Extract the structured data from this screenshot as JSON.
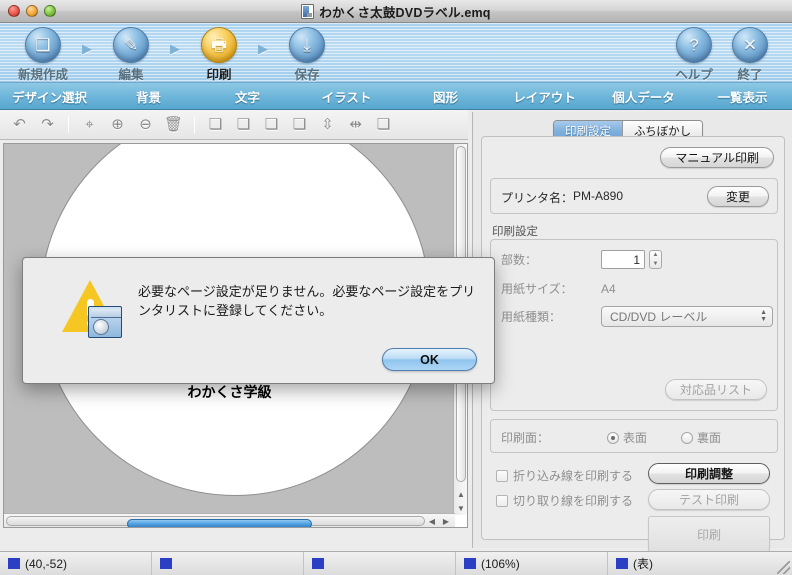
{
  "window": {
    "title": "わかくさ太鼓DVDラベル.emq",
    "doc_icon": "document-icon",
    "close_label": "",
    "minimize_label": "",
    "zoom_label": ""
  },
  "toolbar": {
    "steps": [
      {
        "label": "新規作成",
        "icon": "new-document-icon",
        "active": false
      },
      {
        "label": "編集",
        "icon": "edit-icon",
        "active": false
      },
      {
        "label": "印刷",
        "icon": "print-icon",
        "active": true
      },
      {
        "label": "保存",
        "icon": "save-icon",
        "active": false
      }
    ],
    "arrow": "▶",
    "right_buttons": [
      {
        "label": "ヘルプ",
        "icon": "help-icon",
        "glyph": "?"
      },
      {
        "label": "終了",
        "icon": "close-x-icon",
        "glyph": "✕"
      }
    ]
  },
  "tabs": [
    {
      "label": "デザイン選択"
    },
    {
      "label": "背景"
    },
    {
      "label": "文字"
    },
    {
      "label": "イラスト"
    },
    {
      "label": "図形"
    },
    {
      "label": "レイアウト"
    },
    {
      "label": "個人データ"
    },
    {
      "label": "一覧表示"
    }
  ],
  "icon_toolbar": [
    {
      "name": "undo-icon",
      "glyph": "↶"
    },
    {
      "name": "redo-icon",
      "glyph": "↷"
    },
    {
      "name": "separator",
      "glyph": ""
    },
    {
      "name": "auto-zoom-icon",
      "glyph": "⌖"
    },
    {
      "name": "zoom-in-icon",
      "glyph": "⊕"
    },
    {
      "name": "zoom-out-icon",
      "glyph": "⊖"
    },
    {
      "name": "delete-trash-icon",
      "glyph": "🗑"
    },
    {
      "name": "separator",
      "glyph": ""
    },
    {
      "name": "bring-to-front-icon",
      "glyph": "❏"
    },
    {
      "name": "bring-forward-icon",
      "glyph": "❏"
    },
    {
      "name": "send-backward-icon",
      "glyph": "❏"
    },
    {
      "name": "send-to-back-icon",
      "glyph": "❏"
    },
    {
      "name": "align-vertical-icon",
      "glyph": "⇳"
    },
    {
      "name": "align-horizontal-icon",
      "glyph": "⇹"
    },
    {
      "name": "group-icon",
      "glyph": "❏"
    }
  ],
  "canvas": {
    "label_text": "わかくさ学級",
    "vertical_scrollbar": "vertical-scrollbar",
    "horizontal_scrollbar": "horizontal-scrollbar",
    "scroll_up": "▲",
    "scroll_down": "▼",
    "scroll_left": "◀",
    "scroll_right": "▶"
  },
  "panel": {
    "tabs": [
      {
        "label": "印刷設定",
        "selected": true
      },
      {
        "label": "ふちぼかし",
        "selected": false
      }
    ],
    "manual_print_button": "マニュアル印刷",
    "printer_label": "プリンタ名：",
    "printer_name": "PM-A890",
    "change_button": "変更",
    "print_settings_group": "印刷設定",
    "copies_label": "部数：",
    "copies_value": "1",
    "paper_size_label": "用紙サイズ：",
    "paper_size_value": "A4",
    "paper_type_label": "用紙種類：",
    "paper_type_value": "CD/DVD レーベル",
    "supported_list_button": "対応品リスト",
    "print_side_label": "印刷面：",
    "side_front": "表面",
    "side_back": "裏面",
    "check_fold_line": "折り込み線を印刷する",
    "check_cut_line": "切り取り線を印刷する",
    "print_adjust_button": "印刷調整",
    "test_print_button": "テスト印刷",
    "print_button": "印刷"
  },
  "dialog": {
    "icon": "warning-triangle-icon",
    "message": "必要なページ設定が足りません。必要なページ設定をプリンタリストに登録してください。",
    "ok_button": "OK"
  },
  "statusbar": {
    "coordinates": "(40,-52)",
    "cursor_icon": "cursor-position-icon",
    "object_icon": "object-select-icon",
    "move_icon": "object-move-icon",
    "zoom_icon": "magnifier-icon",
    "zoom_value": "(106%)",
    "side_icon": "print-side-icon",
    "side_value": "(表)"
  },
  "colors": {
    "toolbar_blue": "#a9d2ef",
    "tabstrip_blue": "#6fb6da",
    "active_step_gold": "#f9cf5e",
    "ok_button_blue": "#8fc4ee",
    "warning_yellow": "#f6c723",
    "status_icon_blue": "#2a3fc4"
  }
}
